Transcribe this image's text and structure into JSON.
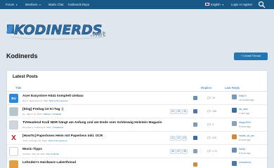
{
  "nav": {
    "items": [
      {
        "label": "Forum"
      },
      {
        "label": "Members"
      },
      {
        "label": "Matrix Chat"
      },
      {
        "label": "Kodinerds Repo"
      }
    ],
    "language": "English",
    "login": "Login or register"
  },
  "logo": {
    "text": "KODINERDS",
    "suffix": ".net"
  },
  "page": {
    "title": "Kodinerds",
    "create_button": "+ Create Thread"
  },
  "latest": {
    "title": "Latest Posts",
    "columns": {
      "title": "Title",
      "replies": "Replies",
      "last_reply": "Last Reply"
    },
    "threads": [
      {
        "avatar_text": "BU",
        "avatar_color": "#2d8ad6",
        "title": "Acer Easystore H341 komplett Umbau",
        "author": "Buzzi",
        "date": "September 8, 2020",
        "forum": "NAS & Homeserver",
        "pages": [],
        "replies": "20",
        "last_user": "bitty13",
        "last_time": "16 minutes ago"
      },
      {
        "avatar_text": "",
        "avatar_color": "#b8c4cc",
        "title": "[blog] Freitag ist Ki-Tag :)",
        "author": "jim",
        "date": "March 14, 2023",
        "forum": "Offtopic / Smalltalk",
        "pages": [
          "14",
          "15",
          "16"
        ],
        "replies": "436",
        "last_user": "da_user",
        "last_time": "1 hour ago"
      },
      {
        "avatar_text": "",
        "avatar_color": "#cfd6dc",
        "title": "TVHeadend Kodi NDR hängt am Anfang und am Ende vom Schleswig Holstein Magazin",
        "author": "Norpost1.0",
        "date": "February 8, 2025",
        "forum": "Tvheadend",
        "pages": [],
        "replies": "3",
        "last_user": "stego2024",
        "last_time": "5 hours ago"
      },
      {
        "avatar_text": "X",
        "avatar_color": "#ffffff",
        "title": "[HowTo] Paperloses Heim mit Paperless inkl. OCR",
        "author": "Yoshi",
        "date": "February 22, 2022",
        "forum": "NAS & Homeserver",
        "pages": [
          "11",
          "12",
          "13"
        ],
        "replies": "325",
        "last_user": "health_at_pro",
        "last_time": "6 hours ago"
      },
      {
        "avatar_text": "",
        "avatar_color": "#ffffff",
        "title": "Music-Tipps",
        "author": "Frachan",
        "date": "May 28, 2012",
        "forum": "Film & Musik",
        "pages": [
          "46",
          "47",
          "48"
        ],
        "replies": "1.7k",
        "last_user": "hardy",
        "last_time": "8 hours ago"
      },
      {
        "avatar_text": "",
        "avatar_color": "#e4a040",
        "title": "Lehnden's Hardware Laberthread",
        "author": "",
        "date": "",
        "forum": "",
        "pages": [],
        "replies": "",
        "last_user": "Lehnden11",
        "last_time": ""
      }
    ]
  },
  "colors": {
    "nav_bg": "#185886",
    "accent": "#2577b1",
    "page_bg": "#dfe6ee"
  },
  "icons": [
    "search-icon",
    "caret-down-icon",
    "uk-flag-icon",
    "comment-icon"
  ]
}
